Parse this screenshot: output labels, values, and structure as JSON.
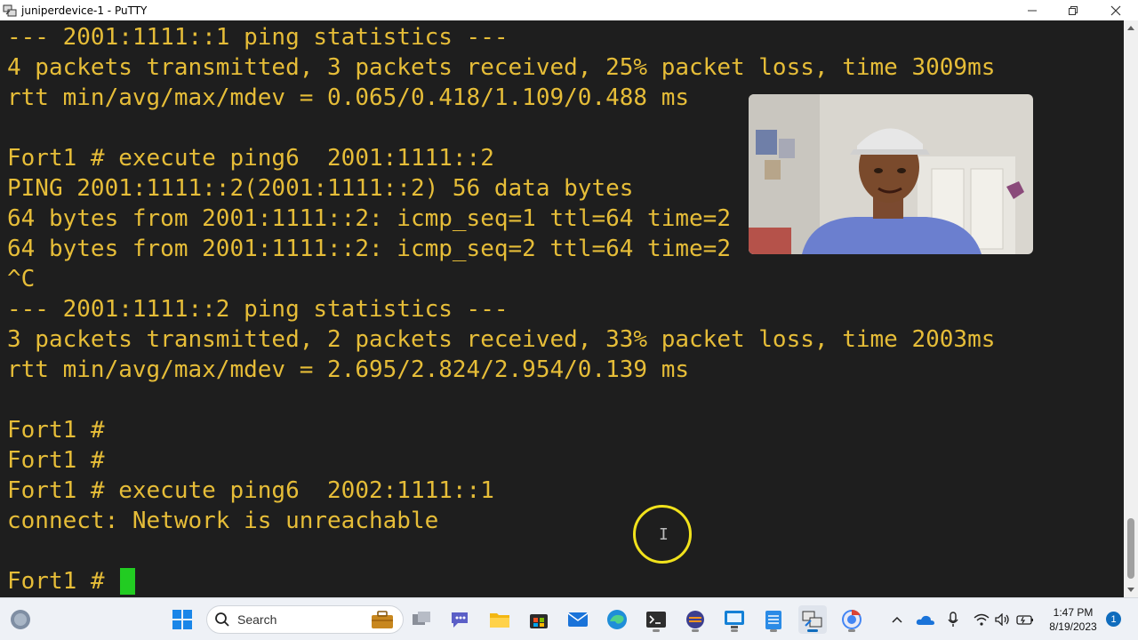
{
  "window": {
    "title": "juniperdevice-1 - PuTTY",
    "minimize_icon": "minimize-icon",
    "maximize_icon": "restore-icon",
    "close_icon": "close-icon"
  },
  "terminal": {
    "text_color": "#e6bd38",
    "background": "#1e1e1e",
    "cursor_color": "#22cc22",
    "lines": [
      "--- 2001:1111::1 ping statistics ---",
      "4 packets transmitted, 3 packets received, 25% packet loss, time 3009ms",
      "rtt min/avg/max/mdev = 0.065/0.418/1.109/0.488 ms",
      "",
      "Fort1 # execute ping6  2001:1111::2",
      "PING 2001:1111::2(2001:1111::2) 56 data bytes",
      "64 bytes from 2001:1111::2: icmp_seq=1 ttl=64 time=2",
      "64 bytes from 2001:1111::2: icmp_seq=2 ttl=64 time=2",
      "^C",
      "--- 2001:1111::2 ping statistics ---",
      "3 packets transmitted, 2 packets received, 33% packet loss, time 2003ms",
      "rtt min/avg/max/mdev = 2.695/2.824/2.954/0.139 ms",
      "",
      "Fort1 #",
      "Fort1 #",
      "Fort1 # execute ping6  2002:1111::1",
      "connect: Network is unreachable",
      "",
      "Fort1 #"
    ]
  },
  "taskbar": {
    "search_label": "Search",
    "icons": [
      "weather-icon",
      "start-icon",
      "search-icon",
      "work-briefcase-icon",
      "task-view-icon",
      "teams-chat-icon",
      "file-explorer-icon",
      "store-icon",
      "mail-icon",
      "edge-icon",
      "terminal-icon",
      "eclipse-icon",
      "remote-desktop-icon",
      "notepad-icon",
      "putty-icon",
      "chrome-icon"
    ],
    "tray_icons": [
      "chevron-up-icon",
      "onedrive-icon",
      "microphone-icon",
      "wifi-icon",
      "volume-icon",
      "battery-icon"
    ],
    "time": "1:47 PM",
    "date": "8/19/2023",
    "notification_count": "1"
  }
}
